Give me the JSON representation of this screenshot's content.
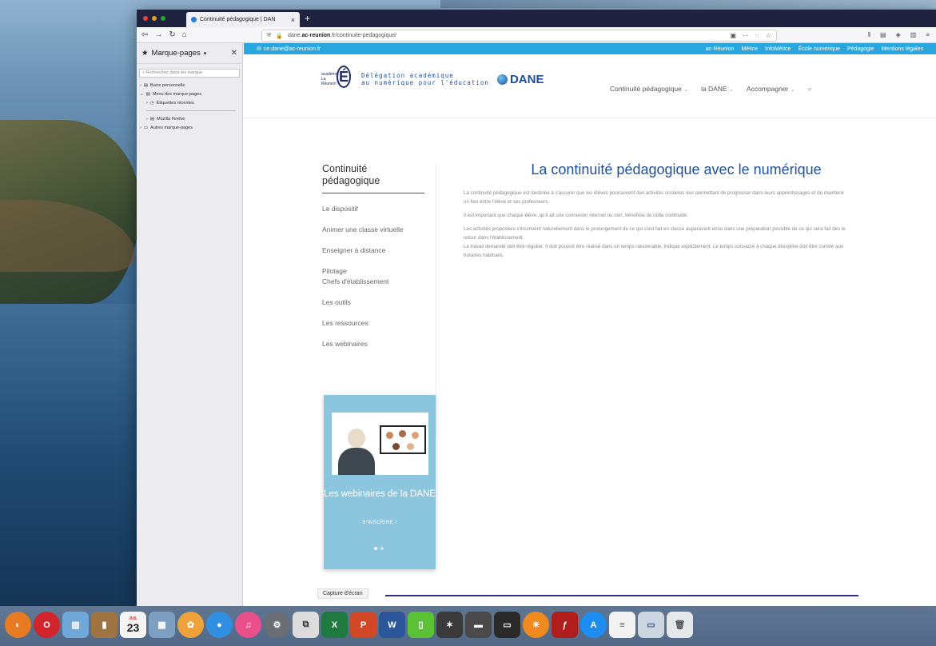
{
  "browser": {
    "tab_title": "Continuité pédagogique | DAN",
    "url_domain": "dane.ac-reunion.fr",
    "url_path": "/continuite-pedagogique/",
    "url_prefix": "dane.",
    "url_host_bold": "ac-reunion",
    "url_suffix": ".fr/continuite-pedagogique/"
  },
  "sidebar": {
    "title": "Marque-pages",
    "search_placeholder": "Rechercher dans les marque",
    "items": [
      {
        "label": "Barre personnelle"
      },
      {
        "label": "Menu des marque-pages"
      },
      {
        "label": "Étiquettes récentes"
      },
      {
        "label": "Mozilla Firefox"
      },
      {
        "label": "Autres marque-pages"
      }
    ]
  },
  "site": {
    "email": "ce.dane@ac-reunion.fr",
    "top_links": [
      "ac-Réunion",
      "Métice",
      "InfoMétice",
      "École numérique",
      "Pédagogie",
      "Mentions légales"
    ],
    "logo_academie": "académie La Réunion",
    "logo_delegation_1": "Délégation académique",
    "logo_delegation_2": "au numérique pour l'éducation",
    "logo_dane": "DANE",
    "main_nav": [
      "Continuité pédagogique",
      "la DANE",
      "Accompagner"
    ],
    "left_nav_title": "Continuité pédagogique",
    "left_nav_items": [
      "Le dispositif",
      "Animer une classe virtuelle",
      "Enseigner à distance",
      "Pilotage\nChefs d'établissement",
      "Les outils",
      "Les ressources",
      "Les webinaires"
    ],
    "heading": "La continuité pédagogique avec le numérique",
    "paragraphs": [
      "La continuité pédagogique est destinée à s'assurer que les élèves poursuivent des activités scolaires leur permettant de progresser dans leurs apprentissages et de maintenir un lien entre l'élève et ses professeurs.",
      "Il est important que chaque élève, qu'il ait une connexion internet ou non, bénéficie de cette continuité.",
      "Les activités proposées s'inscrivent naturellement dans le prolongement de ce qui s'est fait en classe auparavant et/ou dans une préparation possible de ce qui sera fait dès le retour dans l'établissement.\nLe travail demandé doit être régulier. Il doit pouvoir être réalisé dans un temps raisonnable, indiqué explicitement. Le temps consacré à chaque discipline doit être corrélé aux horaires habituels."
    ],
    "promo_title": "Les webinaires de la DANE",
    "promo_cta": "S'INSCRIRE !",
    "capture_label": "Capture d'écran"
  },
  "dock": {
    "calendar_day": "23",
    "calendar_month": "JUIL"
  },
  "colors": {
    "topstrip": "#2aa6df",
    "heading": "#1d4f9c",
    "promo": "#8cc6de",
    "tabbar": "#202340"
  }
}
